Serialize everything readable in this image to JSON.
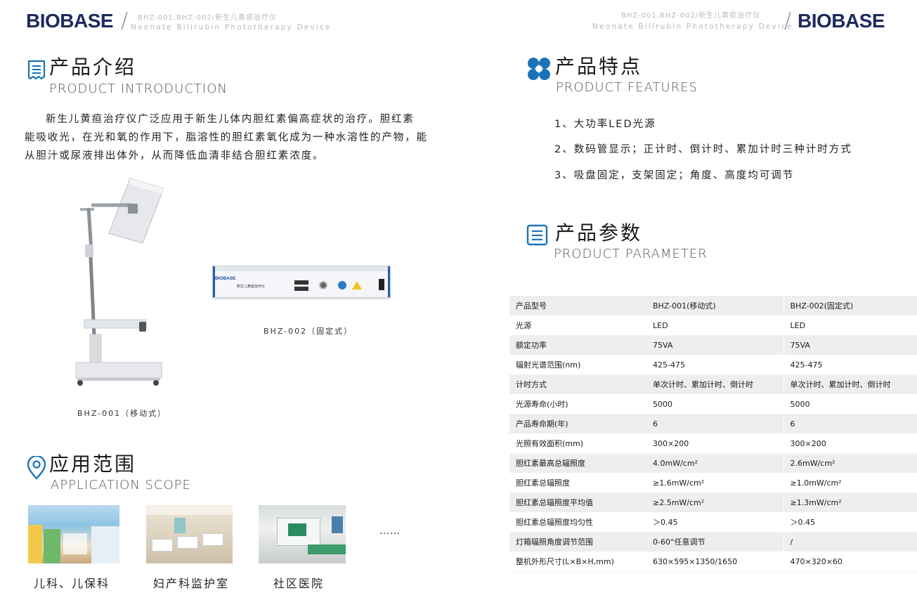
{
  "header_left": {
    "brand": "BIOBASE",
    "models": "BHZ-001,BHZ-002/新生儿黄疸治疗仪",
    "subtitle": "Neonate Bilirubin Phototherapy Device"
  },
  "header_right": {
    "brand": "BIOBASE",
    "models": "BHZ-001,BHZ-002/新生儿黄疸治疗仪",
    "subtitle": "Neonate Bilirubin Phototherapy Device"
  },
  "intro": {
    "title_cn": "产品介绍",
    "title_en": "PRODUCT INTRODUCTION",
    "line1": "新生儿黄疸治疗仪广泛应用于新生儿体内胆红素偏高症状的治疗。胆红素",
    "line2": "能吸收光，在光和氧的作用下，脂溶性的胆红素氧化成为一种水溶性的产物，能",
    "line3": "从胆汁或尿液排出体外，从而降低血清非结合胆红素浓度。"
  },
  "products": {
    "mobile_caption": "BHZ-001（移动式）",
    "fixed_caption": "BHZ-002（固定式）",
    "device_brand": "BIOBASE",
    "device_name": "新生儿黄疸治疗仪"
  },
  "scope": {
    "title_cn": "应用范围",
    "title_en": "APPLICATION  SCOPE",
    "items": [
      "儿科、儿保科",
      "妇产科监护室",
      "社区医院"
    ],
    "more": "……"
  },
  "features": {
    "title_cn": "产品特点",
    "title_en": "PRODUCT    FEATURES",
    "items": [
      "1、大功率LED光源",
      "2、数码管显示；正计时、倒计时、累加计时三种计时方式",
      "3、吸盘固定，支架固定；角度、高度均可调节"
    ]
  },
  "params": {
    "title_cn": "产品参数",
    "title_en": "PRODUCT    PARAMETER",
    "rows": [
      [
        "产品型号",
        "BHZ-001(移动式)",
        "BHZ-002(固定式)"
      ],
      [
        "光源",
        "LED",
        "LED"
      ],
      [
        "额定功率",
        "75VA",
        "75VA"
      ],
      [
        "辐射光谱范围(nm)",
        "425-475",
        "425-475"
      ],
      [
        "计时方式",
        "单次计时、累加计时、倒计时",
        "单次计时、累加计时、倒计时"
      ],
      [
        "光源寿命(小时)",
        "5000",
        "5000"
      ],
      [
        "产品寿命期(年)",
        "6",
        "6"
      ],
      [
        "光照有效面积(mm)",
        "300×200",
        "300×200"
      ],
      [
        "胆红素最高总辐照度",
        "4.0mW/cm²",
        "2.6mW/cm²"
      ],
      [
        "胆红素总辐照度",
        "≥1.6mW/cm²",
        "≥1.0mW/cm²"
      ],
      [
        "胆红素总辐照度平均值",
        "≥2.5mW/cm²",
        "≥1.3mW/cm²"
      ],
      [
        "胆红素总辐照度均匀性",
        "＞0.45",
        "＞0.45"
      ],
      [
        "灯箱辐照角度调节范围",
        "0-60°任意调节",
        "/"
      ],
      [
        "整机外形尺寸(L×B×H,mm)",
        "630×595×1350/1650",
        "470×320×60"
      ]
    ]
  },
  "colors": {
    "brand": "#1d2a5c",
    "accent_blue": "#1a73b8",
    "table_stripe": "#eeeeee"
  },
  "icons": [
    "document-icon",
    "flower-icon",
    "list-icon",
    "location-pin-icon"
  ]
}
